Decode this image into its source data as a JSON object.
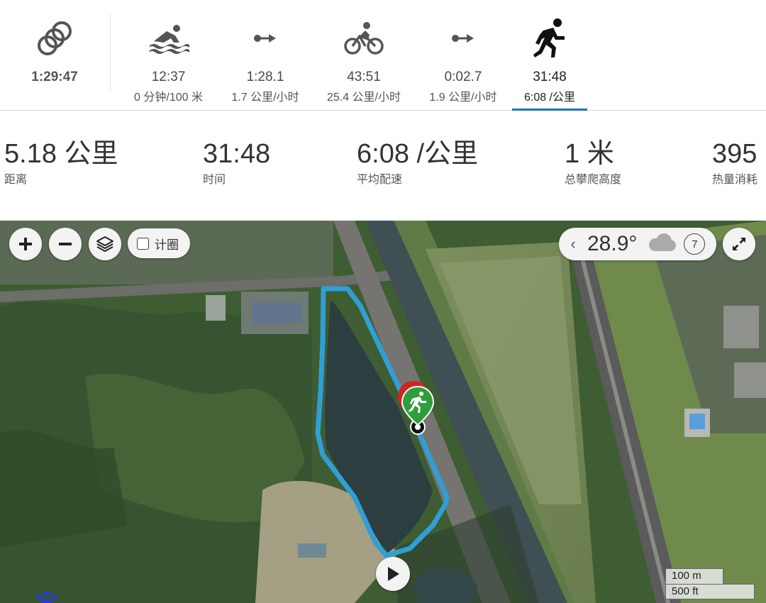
{
  "segments": [
    {
      "id": "total",
      "icon": "multisport-rings-icon",
      "time": "1:29:47",
      "sub": ""
    },
    {
      "id": "swim",
      "icon": "swim-icon",
      "time": "12:37",
      "sub": "0 分钟/100 米"
    },
    {
      "id": "t1",
      "icon": "transition-arrow-icon",
      "time": "1:28.1",
      "sub": "1.7 公里/小时"
    },
    {
      "id": "bike",
      "icon": "bike-icon",
      "time": "43:51",
      "sub": "25.4 公里/小时"
    },
    {
      "id": "t2",
      "icon": "transition-arrow-icon",
      "time": "0:02.7",
      "sub": "1.9 公里/小时"
    },
    {
      "id": "run",
      "icon": "run-icon",
      "time": "31:48",
      "sub": "6:08 /公里",
      "active": true
    }
  ],
  "stats": [
    {
      "value": "5.18 公里",
      "label": "距离"
    },
    {
      "value": "31:48",
      "label": "时间"
    },
    {
      "value": "6:08 /公里",
      "label": "平均配速"
    },
    {
      "value": "1 米",
      "label": "总攀爬高度"
    },
    {
      "value": "395",
      "label": "热量消耗"
    }
  ],
  "map": {
    "lap_toggle_label": "计圈",
    "weather": {
      "temperature": "28.9°",
      "condition_icon": "cloud-icon",
      "wind_speed": "7"
    },
    "scale": {
      "metric": "100 m",
      "imperial": "500 ft"
    },
    "route_color": "#2f9fd6"
  }
}
